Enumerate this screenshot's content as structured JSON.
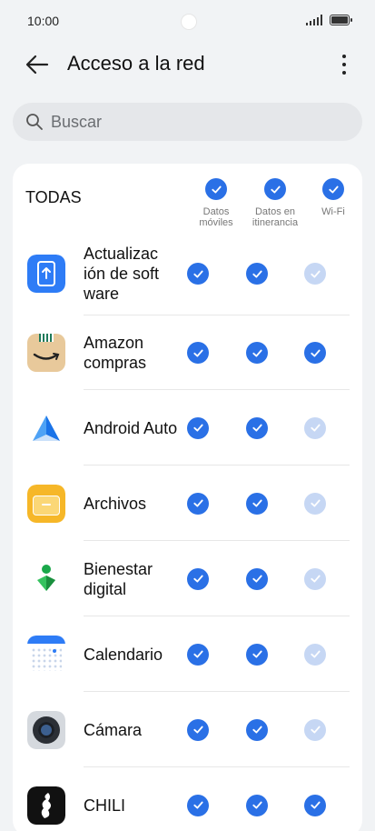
{
  "status": {
    "time": "10:00"
  },
  "header": {
    "title": "Acceso a la red"
  },
  "search": {
    "placeholder": "Buscar"
  },
  "table": {
    "all_label": "TODAS",
    "columns": [
      {
        "label": "Datos móviles"
      },
      {
        "label": "Datos en itinerancia"
      },
      {
        "label": "Wi-Fi"
      }
    ],
    "apps": [
      {
        "name": "Actualización de software",
        "icon": "software-update-icon",
        "mobile": true,
        "roaming": true,
        "wifi": false
      },
      {
        "name": "Amazon compras",
        "icon": "amazon-icon",
        "mobile": true,
        "roaming": true,
        "wifi": true
      },
      {
        "name": "Android Auto",
        "icon": "android-auto-icon",
        "mobile": true,
        "roaming": true,
        "wifi": false
      },
      {
        "name": "Archivos",
        "icon": "files-icon",
        "mobile": true,
        "roaming": true,
        "wifi": false
      },
      {
        "name": "Bienestar digital",
        "icon": "digital-wellbeing-icon",
        "mobile": true,
        "roaming": true,
        "wifi": false
      },
      {
        "name": "Calendario",
        "icon": "calendar-icon",
        "mobile": true,
        "roaming": true,
        "wifi": false
      },
      {
        "name": "Cámara",
        "icon": "camera-icon",
        "mobile": true,
        "roaming": true,
        "wifi": false
      },
      {
        "name": "CHILI",
        "icon": "chili-icon",
        "mobile": true,
        "roaming": true,
        "wifi": true
      }
    ]
  },
  "colors": {
    "accent": "#2a70e6",
    "accent_off": "#c6d7f4",
    "background": "#f1f3f5"
  }
}
